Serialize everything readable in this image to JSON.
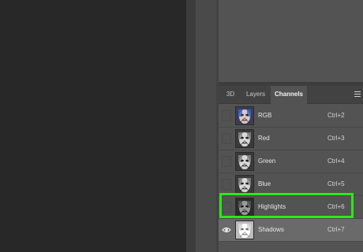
{
  "tabs": [
    {
      "label": "3D",
      "active": false
    },
    {
      "label": "Layers",
      "active": false
    },
    {
      "label": "Channels",
      "active": true
    }
  ],
  "panel_menu_icon": "panel-menu-icon",
  "channels": [
    {
      "name": "RGB",
      "shortcut": "Ctrl+2",
      "visible": false,
      "selected": false,
      "thumbnail": "color"
    },
    {
      "name": "Red",
      "shortcut": "Ctrl+3",
      "visible": false,
      "selected": false,
      "thumbnail": "grayscale"
    },
    {
      "name": "Green",
      "shortcut": "Ctrl+4",
      "visible": false,
      "selected": false,
      "thumbnail": "grayscale"
    },
    {
      "name": "Blue",
      "shortcut": "Ctrl+5",
      "visible": false,
      "selected": false,
      "thumbnail": "grayscale"
    },
    {
      "name": "Highlights",
      "shortcut": "Ctrl+6",
      "visible": false,
      "selected": false,
      "thumbnail": "grayscale-dark"
    },
    {
      "name": "Shadows",
      "shortcut": "Ctrl+7",
      "visible": true,
      "selected": true,
      "thumbnail": "grayscale-light"
    }
  ],
  "highlighted_row": "Highlights",
  "colors": {
    "panel_bg": "#535353",
    "selected_row_bg": "#6a6a6a",
    "highlight_outline": "#2fe51b",
    "canvas_bg": "#282828"
  }
}
